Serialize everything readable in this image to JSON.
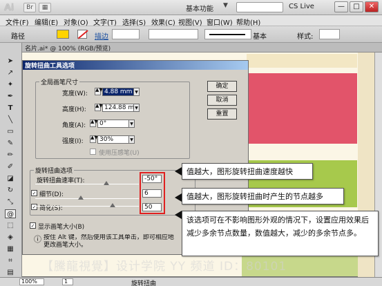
{
  "app": {
    "logo_text": "Ai",
    "workspace": "基本功能",
    "cs_live": "CS Live",
    "window_buttons": [
      "—",
      "□",
      "✕"
    ]
  },
  "menu": [
    "文件(F)",
    "编辑(E)",
    "对象(O)",
    "文字(T)",
    "选择(S)",
    "效果(C)",
    "视图(V)",
    "窗口(W)",
    "帮助(H)"
  ],
  "control_bar": {
    "path_label": "路径",
    "stroke_link": "描边",
    "basic_label": "基本",
    "style_label": "样式:",
    "fill_color": "#ffd400"
  },
  "document_tab": "名片.ai* @ 100% (RGB/预览)",
  "dialog": {
    "title": "旋转扭曲工具选项",
    "global_group": "全局画笔尺寸",
    "width_label": "宽度(W):",
    "width_value": "4.88 mm",
    "height_label": "高度(H):",
    "height_value": "124.88 m",
    "angle_label": "角度(A):",
    "angle_value": "0°",
    "intensity_label": "强度(I):",
    "intensity_value": "30%",
    "pressure_label": "使用压感笔(U)",
    "ok_button": "确定",
    "cancel_button": "取消",
    "reset_button": "重置",
    "twirl_group": "旋转扭曲选项",
    "twirl_rate_label": "旋转扭曲速率(T):",
    "twirl_rate_value": "-50°",
    "detail_label": "细节(D):",
    "detail_value": "6",
    "simplify_label": "简化(S):",
    "simplify_value": "50",
    "show_brush_label": "显示画笔大小(B)",
    "hint_text": "按住 Alt 键，然后使用该工具单击，即可相应地更改画笔大小。",
    "check_mark": "✓"
  },
  "callouts": {
    "twirl_rate": "值越大，图形旋转扭曲速度越快",
    "detail": "值越大，图形旋转扭曲时产生的节点越多",
    "simplify": "该选项可在不影响图形外观的情况下，设置应用效果后减少多余节点数量，数值越大，减少的多余节点多。"
  },
  "watermark": "【騰龍視覺】设计学院  YY 频道 ID：80101",
  "status_bar": {
    "zoom": "100%",
    "page": "1",
    "current_tool": "旋转扭曲"
  },
  "colors": {
    "accent_red": "#e02020",
    "artwork_pink": "#e2546a",
    "artwork_green": "#a7c94c"
  }
}
